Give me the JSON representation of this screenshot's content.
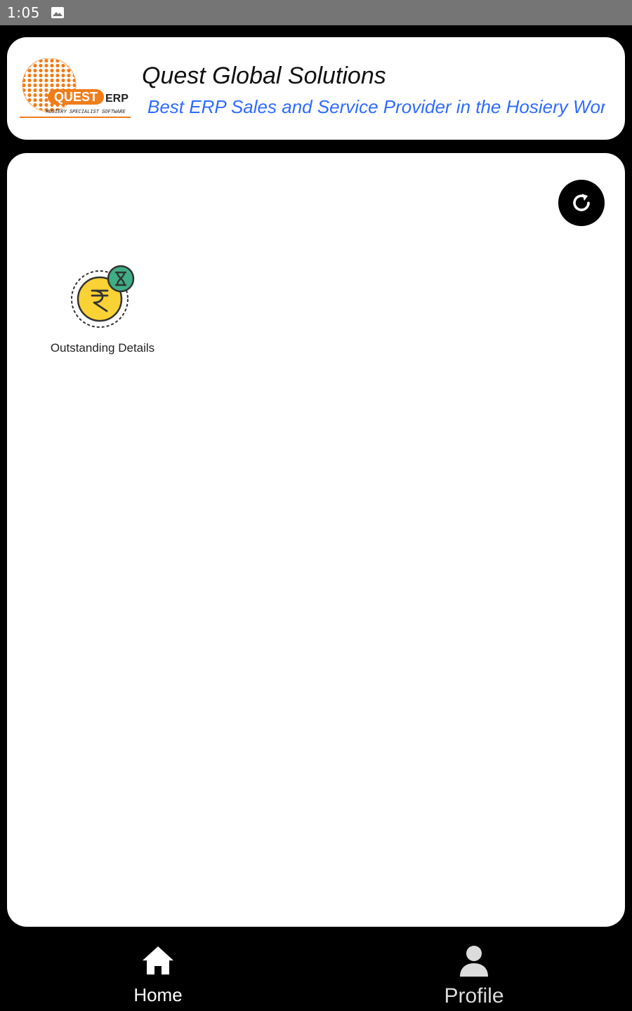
{
  "status_bar": {
    "time": "1:05",
    "icons": [
      "image-notification-icon"
    ]
  },
  "header": {
    "logo": {
      "name": "quest-erp-logo",
      "wordmark": "QUEST",
      "suffix": "ERP",
      "tagline": "HOSIERY SPECIALIST SOFTWARE"
    },
    "title": "Quest Global Solutions",
    "tagline": "Best ERP Sales and Service Provider in the Hosiery World"
  },
  "main": {
    "refresh_icon": "refresh-icon",
    "tiles": [
      {
        "label": "Outstanding Details",
        "icon": "rupee-coin-hourglass-icon"
      }
    ]
  },
  "bottom_nav": {
    "items": [
      {
        "label": "Home",
        "icon": "home-icon",
        "active": true
      },
      {
        "label": "Profile",
        "icon": "person-icon",
        "active": false
      }
    ]
  },
  "colors": {
    "status_bar": "#757575",
    "background": "#000000",
    "card": "#ffffff",
    "tagline": "#2f6bff",
    "logo_orange": "#ef7d1a",
    "coin_yellow": "#fbd235",
    "hourglass_badge": "#3fae86"
  }
}
